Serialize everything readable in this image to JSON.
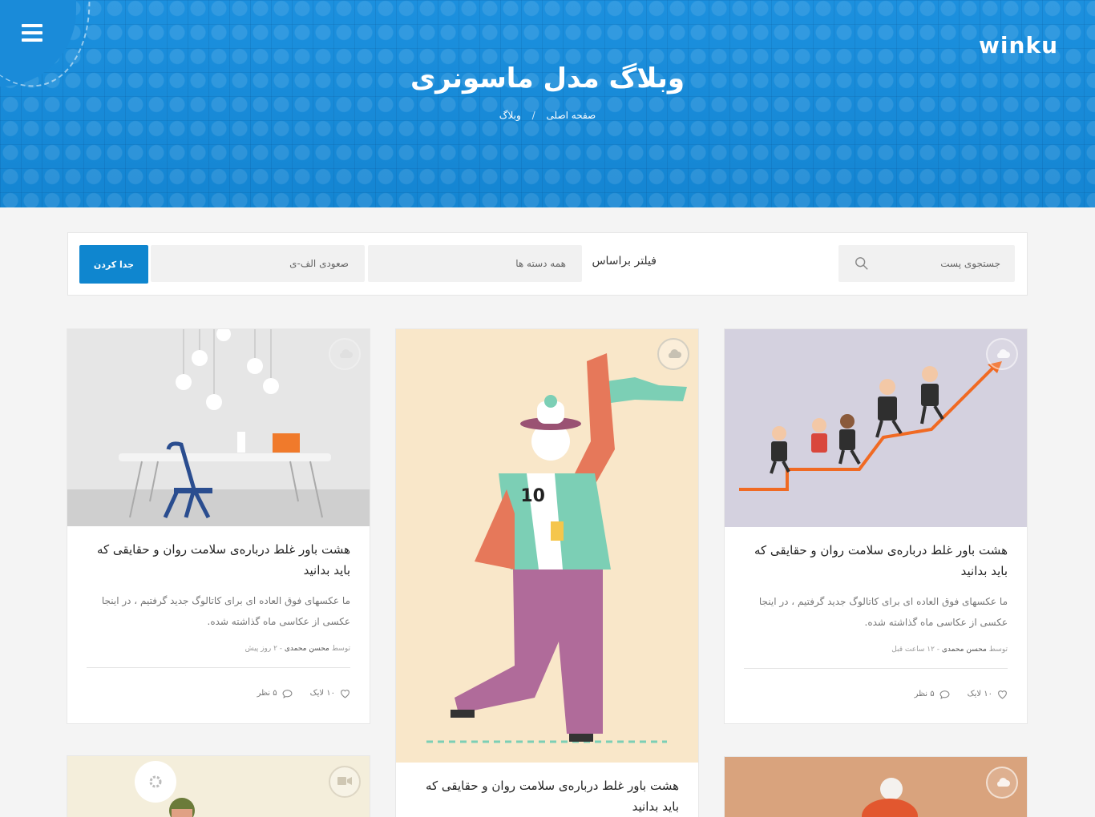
{
  "header": {
    "logo": "winku",
    "title": "وبلاگ مدل ماسونری",
    "breadcrumb": {
      "home": "صفحه اصلی",
      "separator": "/",
      "current": "وبلاگ"
    }
  },
  "filters": {
    "search_placeholder": "جستجوی پست",
    "filter_label": "فیلتر براساس",
    "category": "همه دسته ها",
    "sort": "صعودی الف-ی",
    "apply_label": "جدا کردن"
  },
  "colors": {
    "brand": "#1a8ad7",
    "button": "#0f86cf"
  },
  "posts": [
    {
      "title": "هشت باور غلط درباره‌ی سلامت روان و حقایقی که باید بدانید",
      "excerpt": "ما عکسهای فوق العاده ای برای کاتالوگ جدید گرفتیم ، در اینجا عکسی از عکاسی ماه گذاشته شده.",
      "meta_prefix": "توسط",
      "author": "محسن محمدی",
      "time": "- ۱۲ ساعت قبل",
      "likes": "۱۰ لایک",
      "comments": "۵ نظر",
      "badge_icon": "cloud-icon"
    },
    {
      "title": "هشت باور غلط درباره‌ی سلامت روان و حقایقی که باید بدانید",
      "badge_icon": "cloud-icon"
    },
    {
      "title": "هشت باور غلط درباره‌ی سلامت روان و حقایقی که باید بدانید",
      "excerpt": "ما عکسهای فوق العاده ای برای کاتالوگ جدید گرفتیم ، در اینجا عکسی از عکاسی ماه گذاشته شده.",
      "meta_prefix": "توسط",
      "author": "محسن محمدی",
      "time": "- ۲ روز پیش",
      "likes": "۱۰ لایک",
      "comments": "۵ نظر",
      "badge_icon": "cloud-icon"
    },
    {
      "badge_icon": "cloud-icon"
    },
    {
      "badge_icon": "video-icon"
    }
  ]
}
